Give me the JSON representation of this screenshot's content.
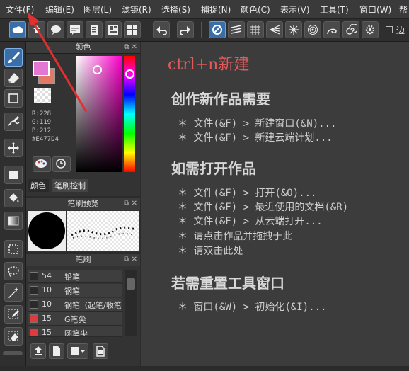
{
  "menubar": {
    "items": [
      "文件(F)",
      "编辑(E)",
      "图层(L)",
      "滤镜(R)",
      "选择(S)",
      "捕捉(N)",
      "颜色(C)",
      "表示(V)",
      "工具(T)",
      "窗口(W)",
      "帮"
    ]
  },
  "toolbar": {
    "snap_label": "边"
  },
  "color_panel": {
    "title": "颜色",
    "r": "R:228",
    "g": "G:119",
    "b": "B:212",
    "hex": "#E477D4",
    "tab_color": "颜色",
    "tab_brush": "笔刷控制",
    "current_color": "#e477d4"
  },
  "brush_preview": {
    "title": "笔刷预览"
  },
  "brush_panel": {
    "title": "笔刷",
    "rows": [
      {
        "size": "54",
        "name": "铅笔",
        "color": "#2a2a2a"
      },
      {
        "size": "10",
        "name": "钢笔",
        "color": "#2a2a2a"
      },
      {
        "size": "10",
        "name": "钢笔（起笔/收笔",
        "color": "#2a2a2a"
      },
      {
        "size": "15",
        "name": "G笔尖",
        "color": "#e03a3a"
      },
      {
        "size": "15",
        "name": "圆笔尖",
        "color": "#e03a3a"
      }
    ]
  },
  "canvas": {
    "shortcut": "ctrl+n新建",
    "sec1_title": "创作新作品需要",
    "sec1_items": [
      "＊ 文件(&F) > 新建窗口(&N)...",
      "＊ 文件(&F) > 新建云端计划..."
    ],
    "sec2_title": "如需打开作品",
    "sec2_items": [
      "＊ 文件(&F) > 打开(&O)...",
      "＊ 文件(&F) > 最近使用的文档(&R)",
      "＊ 文件(&F) > 从云端打开...",
      "＊ 请点击作品并拖拽于此",
      "＊ 请双击此处"
    ],
    "sec3_title": "若需重置工具窗口",
    "sec3_items": [
      "＊ 窗口(&W) > 初始化(&I)..."
    ]
  }
}
